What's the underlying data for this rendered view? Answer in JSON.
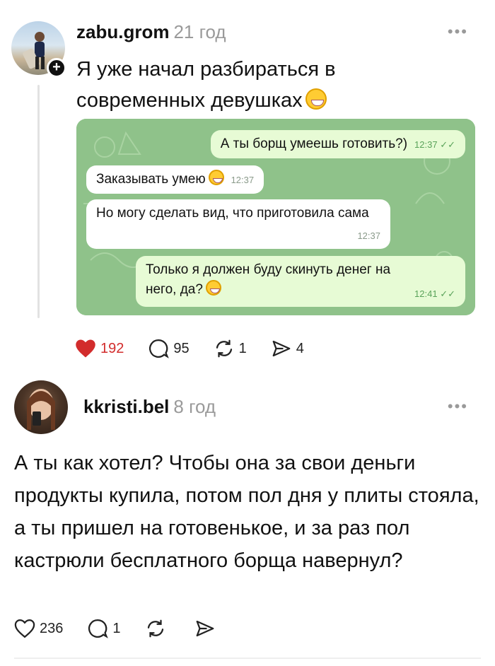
{
  "post1": {
    "username": "zabu.grom",
    "age": "21 год",
    "text_line1": "Я уже начал разбираться в",
    "text_line2": "современных девушках",
    "chat": {
      "msg1": {
        "text": "А ты борщ умеешь готовить?)",
        "time": "12:37"
      },
      "msg2": {
        "text": "Заказывать умею",
        "time": "12:37"
      },
      "msg3": {
        "text": "Но могу сделать вид, что приготовила сама",
        "time": "12:37"
      },
      "msg4": {
        "text": "Только я должен буду скинуть денег на него, да?",
        "time": "12:41"
      }
    },
    "likes": "192",
    "comments": "95",
    "reposts": "1",
    "shares": "4"
  },
  "post2": {
    "username": "kkristi.bel",
    "age": "8 год",
    "text": "А ты как хотел? Чтобы она за свои деньги продукты купила, потом пол дня у плиты стояла, а ты пришел на готовенькое, и за раз пол кастрюли бесплатного борща навернул?",
    "likes": "236",
    "comments": "1"
  },
  "colors": {
    "like_red": "#d22c2c",
    "chat_green": "#8fc28a",
    "out_bubble": "#e7fbd5"
  }
}
